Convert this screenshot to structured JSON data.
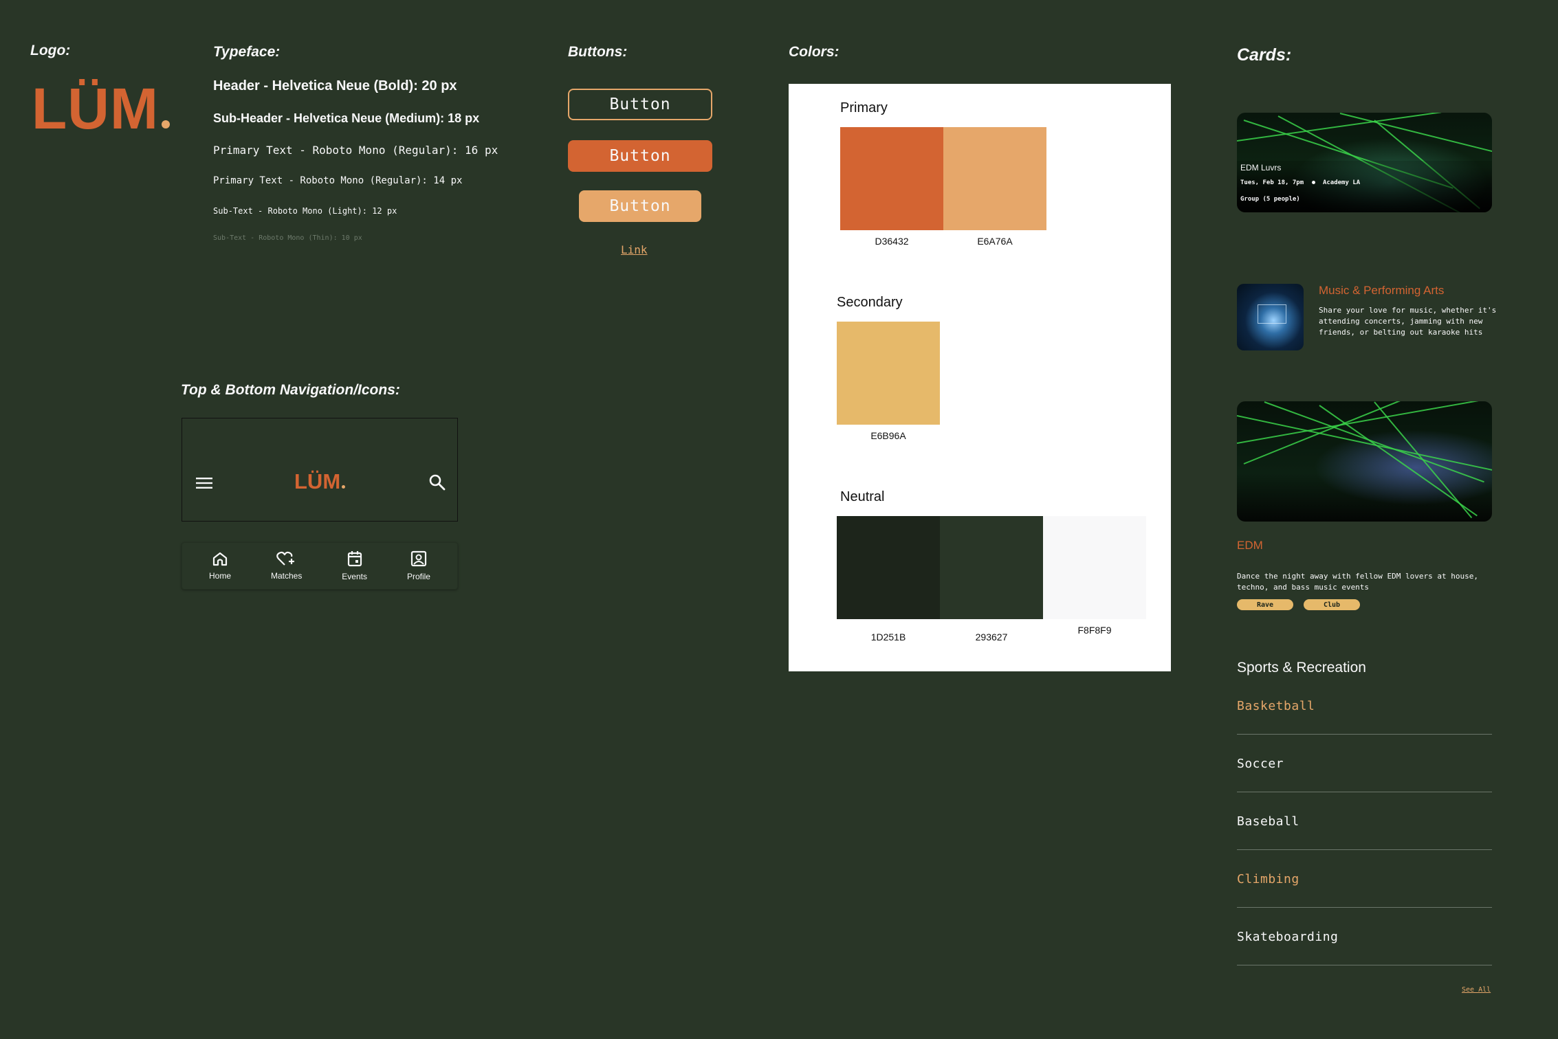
{
  "logo": {
    "title": "Logo:",
    "wordmark": "LÜM"
  },
  "typeface": {
    "title": "Typeface:",
    "header": "Header - Helvetica Neue (Bold): 20 px",
    "subheader": "Sub-Header - Helvetica Neue (Medium): 18 px",
    "primary16": "Primary Text - Roboto Mono (Regular): 16 px",
    "primary14": "Primary Text - Roboto Mono (Regular): 14 px",
    "subtext12": "Sub-Text - Roboto Mono (Light): 12 px",
    "subtext10": "Sub-Text - Roboto Mono (Thin): 10 px"
  },
  "buttons": {
    "title": "Buttons:",
    "outline_label": "Button",
    "primary_label": "Button",
    "secondary_label": "Button",
    "link_label": "Link"
  },
  "colors": {
    "title": "Colors:",
    "primary": {
      "label": "Primary",
      "swatches": [
        {
          "hex": "D36432",
          "color": "#D36432"
        },
        {
          "hex": "E6A76A",
          "color": "#E6A76A"
        }
      ]
    },
    "secondary": {
      "label": "Secondary",
      "swatches": [
        {
          "hex": "E6B96A",
          "color": "#E6B96A"
        }
      ]
    },
    "neutral": {
      "label": "Neutral",
      "swatches": [
        {
          "hex": "1D251B",
          "color": "#1D251B"
        },
        {
          "hex": "293627",
          "color": "#293627"
        },
        {
          "hex": "F8F8F9",
          "color": "#F8F8F9"
        }
      ]
    }
  },
  "navigation": {
    "title": "Top & Bottom Navigation/Icons:",
    "top": {
      "logo": "LÜM",
      "left_icon": "hamburger-menu-icon",
      "right_icon": "search-icon"
    },
    "bottom": [
      {
        "label": "Home",
        "icon": "home-icon"
      },
      {
        "label": "Matches",
        "icon": "heart-plus-icon"
      },
      {
        "label": "Events",
        "icon": "calendar-icon"
      },
      {
        "label": "Profile",
        "icon": "profile-icon"
      }
    ]
  },
  "cards": {
    "title": "Cards:",
    "event_card": {
      "title": "EDM Luvrs",
      "details": "Tues, Feb 18, 7pm",
      "location": "Academy LA",
      "group": "Group (5 people)"
    },
    "category_card": {
      "title": "Music & Performing Arts",
      "description": "Share your love for music, whether it's attending concerts, jamming with new friends, or belting out karaoke hits"
    },
    "genre_card": {
      "title": "EDM",
      "description": "Dance the night away with fellow EDM lovers at house, techno, and bass music events",
      "tags": [
        "Rave",
        "Club"
      ]
    },
    "sports": {
      "title": "Sports & Recreation",
      "items": [
        {
          "label": "Basketball",
          "color": "#E6A76A"
        },
        {
          "label": "Soccer",
          "color": "#F8F8F9"
        },
        {
          "label": "Baseball",
          "color": "#F8F8F9"
        },
        {
          "label": "Climbing",
          "color": "#E6A76A"
        },
        {
          "label": "Skateboarding",
          "color": "#F8F8F9"
        }
      ],
      "see_all": "See All"
    }
  }
}
